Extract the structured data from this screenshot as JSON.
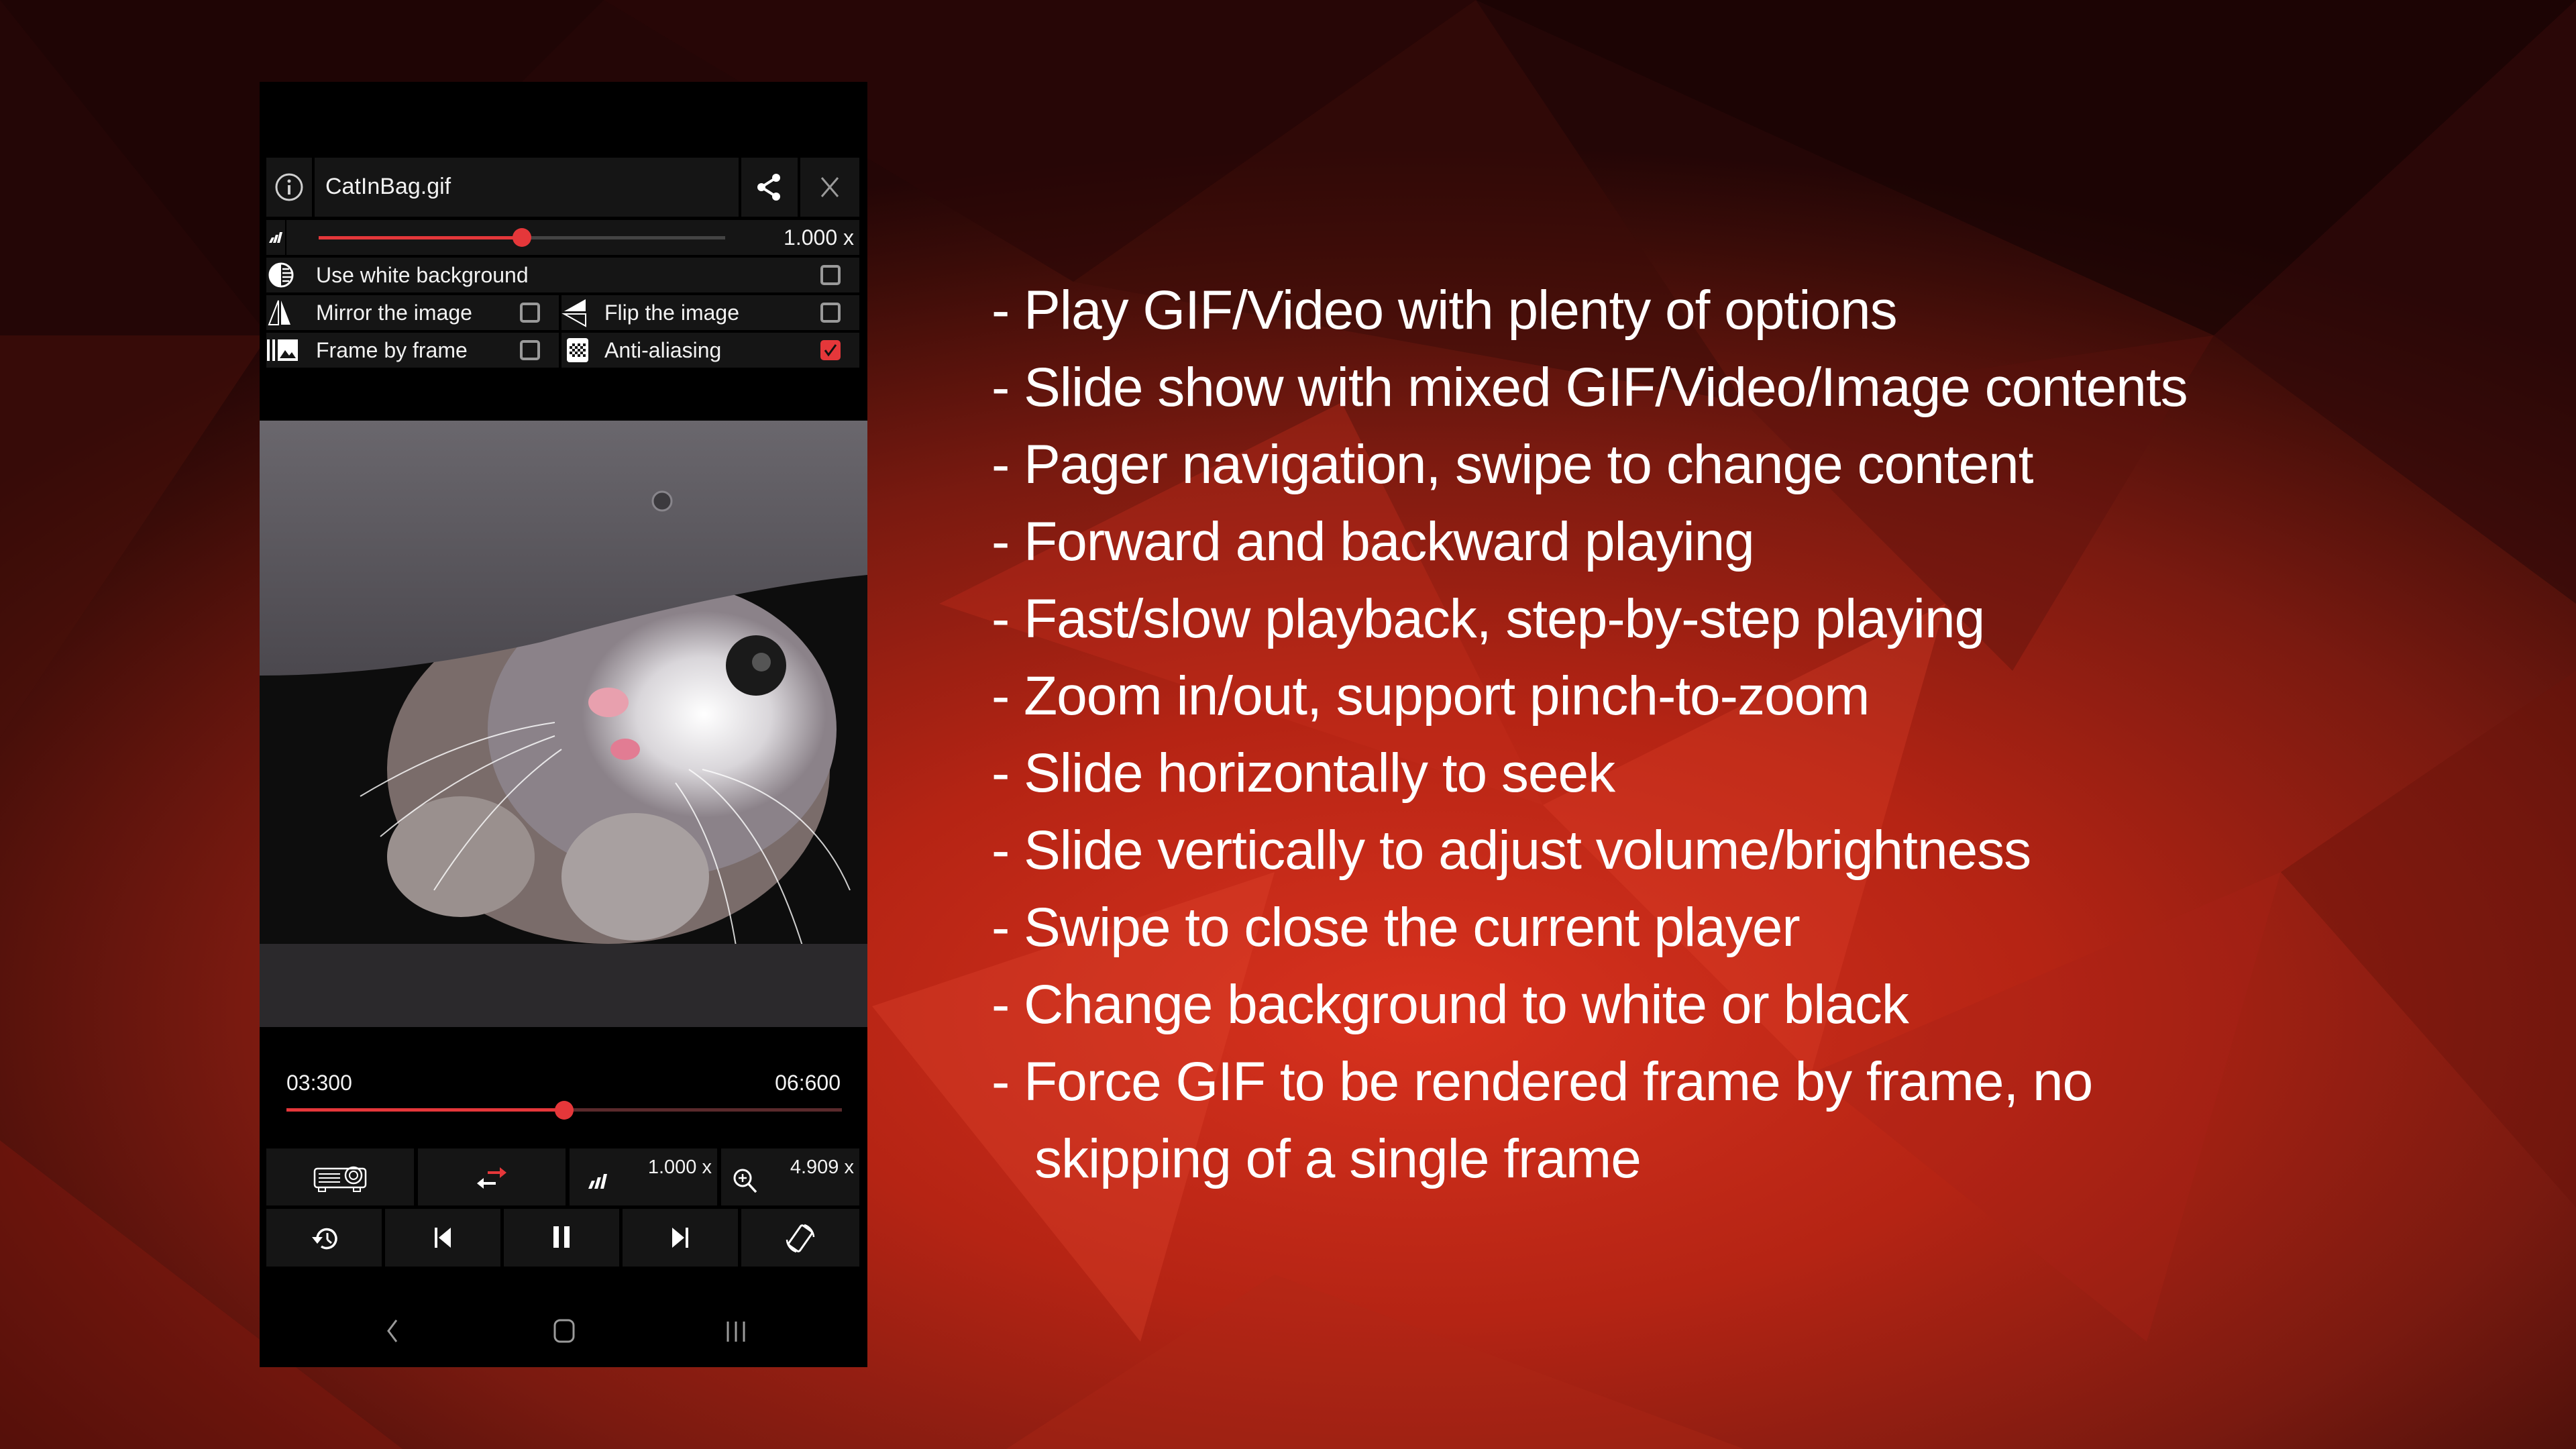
{
  "app": {
    "file_name": "CatInBag.gif",
    "speed_slider": {
      "value_label": "1.000 x",
      "fraction": 0.5
    },
    "options": [
      {
        "label": "Use white background",
        "checked": false
      },
      {
        "label": "Mirror the image",
        "checked": false
      },
      {
        "label": "Flip the image",
        "checked": false
      },
      {
        "label": "Frame by frame",
        "checked": false
      },
      {
        "label": "Anti-aliasing",
        "checked": true
      }
    ],
    "playback": {
      "current_time": "03:300",
      "total_time": "06:600",
      "progress_fraction": 0.5
    },
    "controls": {
      "speed_label": "1.000 x",
      "zoom_label": "4.909 x"
    },
    "accent_color": "#e5373a"
  },
  "features": [
    "- Play GIF/Video with plenty of options",
    "- Slide show with mixed GIF/Video/Image contents",
    "- Pager navigation, swipe to change content",
    "- Forward and backward playing",
    "- Fast/slow playback, step-by-step playing",
    "- Zoom in/out, support pinch-to-zoom",
    "- Slide horizontally to seek",
    "- Slide vertically to adjust volume/brightness",
    "- Swipe to close the current player",
    "- Change background to white or black",
    "- Force GIF to be rendered frame by frame, no",
    "skipping of a single frame"
  ]
}
